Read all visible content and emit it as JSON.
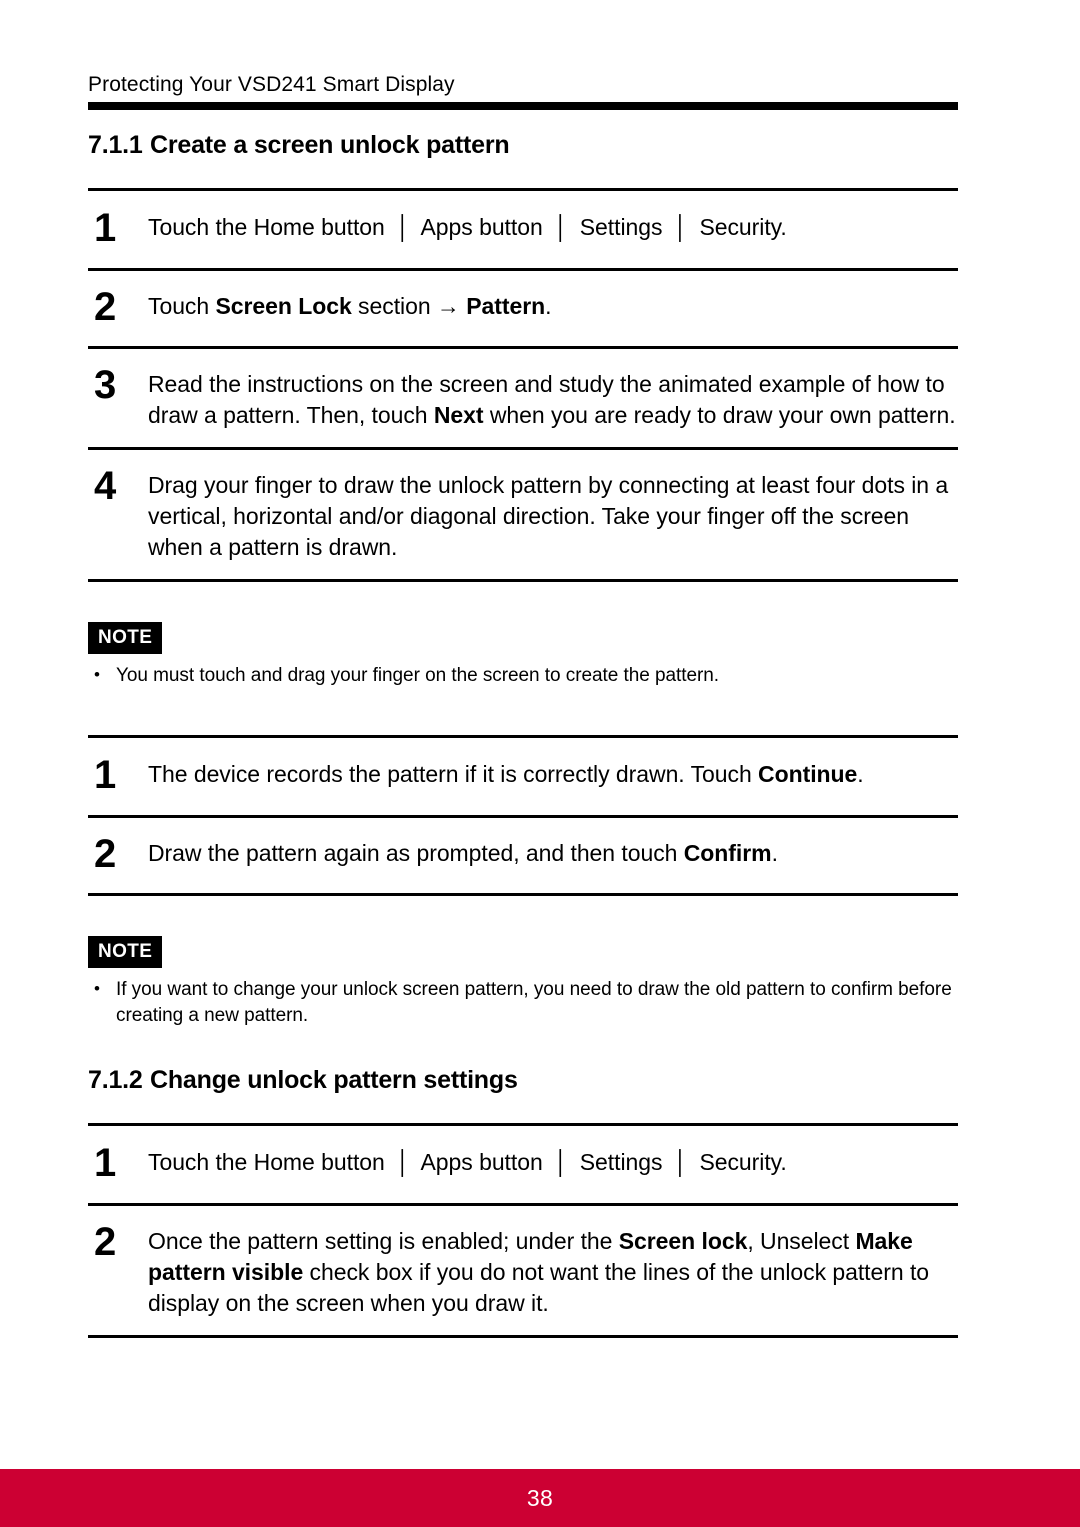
{
  "header": {
    "running_title": "Protecting Your VSD241 Smart Display"
  },
  "sections": [
    {
      "number": "7.1.1",
      "title": "Create a screen unlock pattern"
    },
    {
      "number": "7.1.2",
      "title": "Change unlock pattern settings"
    }
  ],
  "steps_group_1": [
    {
      "num": "1",
      "parts": [
        {
          "text": "Touch the Home button ",
          "bold": false
        },
        {
          "text": "│",
          "bold": false,
          "sep": true
        },
        {
          "text": " Apps button ",
          "bold": false
        },
        {
          "text": "│",
          "bold": false,
          "sep": true
        },
        {
          "text": " Settings ",
          "bold": false
        },
        {
          "text": "│",
          "bold": false,
          "sep": true
        },
        {
          "text": " Security.",
          "bold": false
        }
      ],
      "plain": "Touch the Home button | Apps button | Settings | Security."
    },
    {
      "num": "2",
      "parts": [
        {
          "text": "Touch ",
          "bold": false
        },
        {
          "text": "Screen Lock",
          "bold": true
        },
        {
          "text": " section → ",
          "bold": false
        },
        {
          "text": "Pattern",
          "bold": true
        },
        {
          "text": ".",
          "bold": false
        }
      ],
      "plain": "Touch Screen Lock section → Pattern."
    },
    {
      "num": "3",
      "parts": [
        {
          "text": "Read the instructions on the screen and study the animated example of how to draw a pattern. Then, touch ",
          "bold": false
        },
        {
          "text": "Next",
          "bold": true
        },
        {
          "text": " when you are ready to draw your own pattern.",
          "bold": false
        }
      ],
      "plain": "Read the instructions on the screen and study the animated example of how to draw a pattern. Then, touch Next when you are ready to draw your own pattern."
    },
    {
      "num": "4",
      "parts": [
        {
          "text": "Drag your finger to draw the unlock pattern by connecting at least four dots in a vertical, horizontal and/or diagonal direction. Take your finger off the screen when a pattern is drawn.",
          "bold": false
        }
      ],
      "plain": "Drag your finger to draw the unlock pattern by connecting at least four dots in a vertical, horizontal and/or diagonal direction. Take your finger off the screen when a pattern is drawn."
    }
  ],
  "note_1": {
    "badge": "NOTE",
    "items": [
      "You must touch and drag your finger on the screen to create the pattern."
    ]
  },
  "steps_group_2": [
    {
      "num": "1",
      "parts": [
        {
          "text": "The device records the pattern if it is correctly drawn. Touch ",
          "bold": false
        },
        {
          "text": "Continue",
          "bold": true
        },
        {
          "text": ".",
          "bold": false
        }
      ],
      "plain": "The device records the pattern if it is correctly drawn. Touch Continue."
    },
    {
      "num": "2",
      "parts": [
        {
          "text": "Draw the pattern again as prompted, and then touch ",
          "bold": false
        },
        {
          "text": "Confirm",
          "bold": true
        },
        {
          "text": ".",
          "bold": false
        }
      ],
      "plain": "Draw the pattern again as prompted, and then touch Confirm."
    }
  ],
  "note_2": {
    "badge": "NOTE",
    "items": [
      "If you want to change your unlock screen pattern, you need to draw the old pattern to confirm before creating a new pattern."
    ]
  },
  "steps_group_3": [
    {
      "num": "1",
      "parts": [
        {
          "text": "Touch the Home button ",
          "bold": false
        },
        {
          "text": "│",
          "bold": false,
          "sep": true
        },
        {
          "text": " Apps button ",
          "bold": false
        },
        {
          "text": "│",
          "bold": false,
          "sep": true
        },
        {
          "text": " Settings ",
          "bold": false
        },
        {
          "text": "│",
          "bold": false,
          "sep": true
        },
        {
          "text": " Security.",
          "bold": false
        }
      ],
      "plain": "Touch the Home button | Apps button | Settings | Security."
    },
    {
      "num": "2",
      "parts": [
        {
          "text": "Once the pattern setting is enabled; under the ",
          "bold": false
        },
        {
          "text": "Screen lock",
          "bold": true
        },
        {
          "text": ", Unselect ",
          "bold": false
        },
        {
          "text": "Make pattern visible",
          "bold": true
        },
        {
          "text": " check box if you do not want the lines of the unlock pattern to display on the screen when you draw it.",
          "bold": false
        }
      ],
      "plain": "Once the pattern setting is enabled; under the Screen lock, Unselect Make pattern visible check box if you do not want the lines of the unlock pattern to display on the screen when you draw it."
    }
  ],
  "footer": {
    "page_number": "38",
    "bar_color": "#CC0033"
  }
}
